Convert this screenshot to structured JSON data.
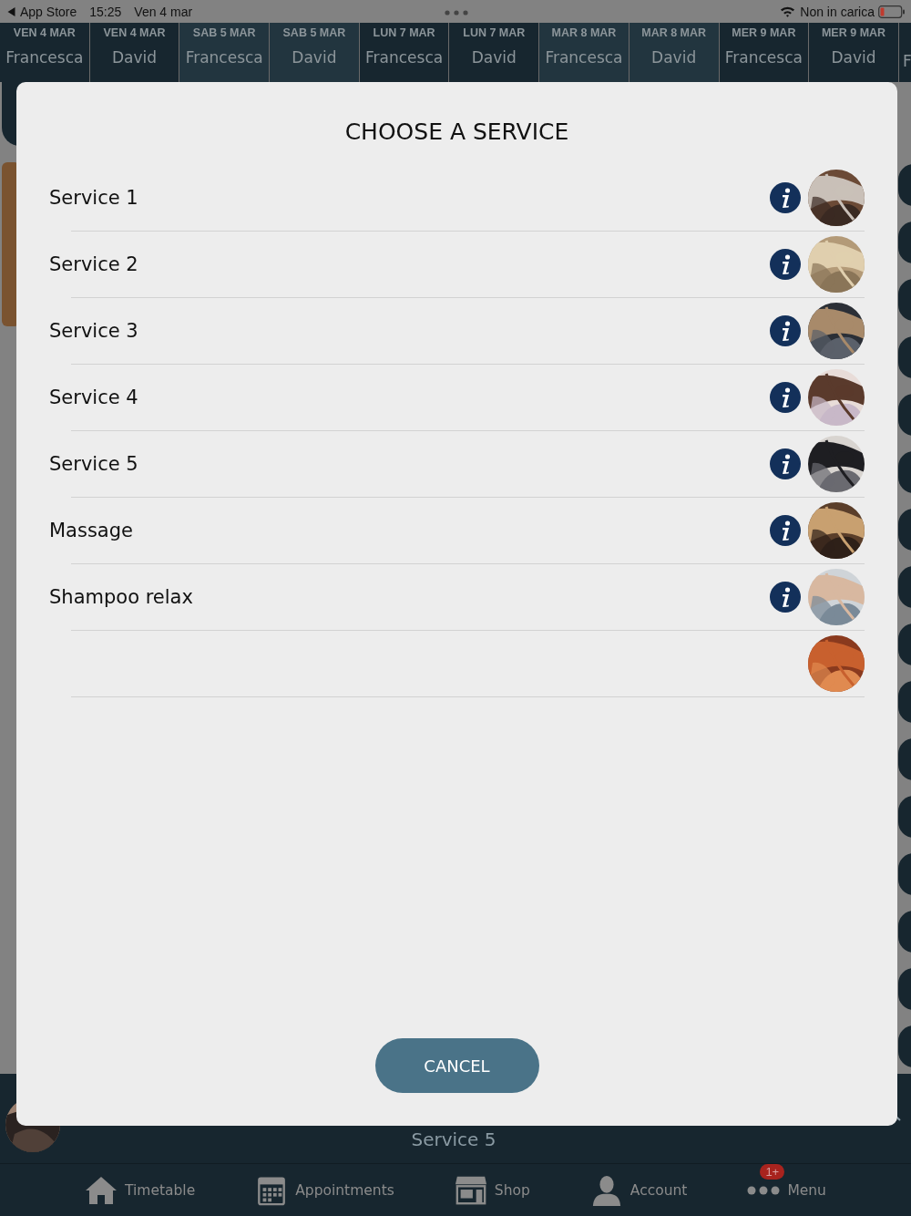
{
  "status_bar": {
    "back_label": "App Store",
    "time": "15:25",
    "date": "Ven 4 mar",
    "charging": "Non in carica"
  },
  "schedule_tabs": [
    {
      "day": "VEN 4 MAR",
      "name": "Francesca",
      "color": "#17262f"
    },
    {
      "day": "VEN 4 MAR",
      "name": "David",
      "color": "#17262f"
    },
    {
      "day": "SAB 5 MAR",
      "name": "Francesca",
      "color": "#22353f"
    },
    {
      "day": "SAB 5 MAR",
      "name": "David",
      "color": "#22353f"
    },
    {
      "day": "LUN 7 MAR",
      "name": "Francesca",
      "color": "#17262f"
    },
    {
      "day": "LUN 7 MAR",
      "name": "David",
      "color": "#17262f"
    },
    {
      "day": "MAR 8 MAR",
      "name": "Francesca",
      "color": "#22353f"
    },
    {
      "day": "MAR 8 MAR",
      "name": "David",
      "color": "#22353f"
    },
    {
      "day": "MER 9 MAR",
      "name": "Francesca",
      "color": "#17262f"
    },
    {
      "day": "MER 9 MAR",
      "name": "David",
      "color": "#17262f"
    }
  ],
  "partial_tab": {
    "name": "F"
  },
  "dialog": {
    "title": "CHOOSE A SERVICE",
    "services": [
      {
        "name": "Service 1",
        "info": true
      },
      {
        "name": "Service 2",
        "info": true
      },
      {
        "name": "Service 3",
        "info": true
      },
      {
        "name": "Service 4",
        "info": true
      },
      {
        "name": "Service 5",
        "info": true
      },
      {
        "name": "Massage",
        "info": true
      },
      {
        "name": "Shampoo relax",
        "info": true
      },
      {
        "info": false
      }
    ],
    "cancel": "CANCEL"
  },
  "current_booking": {
    "service": "Service 5"
  },
  "tab_bar": [
    {
      "kind": "home",
      "label": "Timetable"
    },
    {
      "kind": "calendar",
      "label": "Appointments"
    },
    {
      "kind": "shop",
      "label": "Shop"
    },
    {
      "kind": "account",
      "label": "Account"
    },
    {
      "kind": "menu",
      "label": "Menu",
      "badge": "1+"
    }
  ]
}
